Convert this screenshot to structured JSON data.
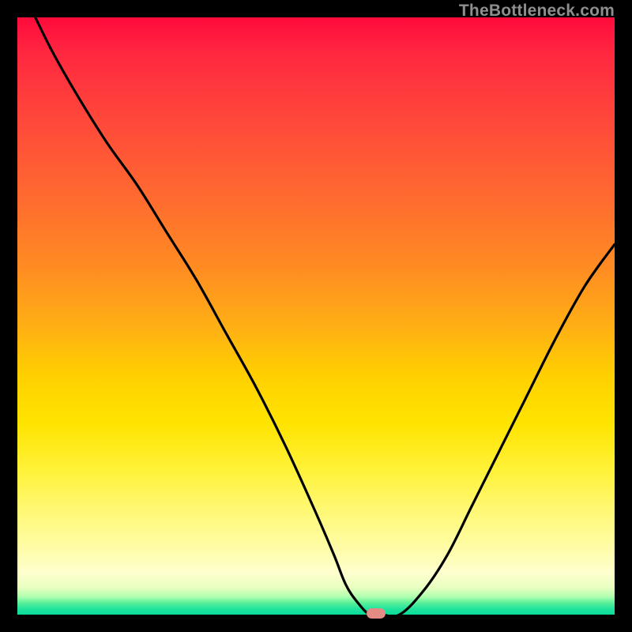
{
  "watermark": "TheBottleneck.com",
  "colors": {
    "background": "#000000",
    "gradient_top": "#ff0a3c",
    "gradient_mid": "#ffd000",
    "gradient_bottom": "#08dc9a",
    "curve": "#000000",
    "marker": "#e58b86",
    "watermark": "#8e8e8e"
  },
  "chart_data": {
    "type": "line",
    "title": "",
    "xlabel": "",
    "ylabel": "",
    "xlim": [
      0,
      100
    ],
    "ylim": [
      0,
      100
    ],
    "series": [
      {
        "name": "curve",
        "x": [
          3,
          6,
          10,
          15,
          20,
          25,
          30,
          35,
          40,
          45,
          50,
          53,
          55,
          57,
          59,
          61,
          64,
          68,
          72,
          76,
          80,
          85,
          90,
          95,
          100
        ],
        "y": [
          100,
          94,
          87,
          79,
          72,
          64,
          56,
          47,
          38,
          28,
          17,
          10,
          5,
          2,
          0,
          0,
          0,
          4,
          10,
          18,
          26,
          36,
          46,
          55,
          62
        ]
      }
    ],
    "marker": {
      "x": 60,
      "y": 0
    },
    "grid": false,
    "legend": false
  }
}
